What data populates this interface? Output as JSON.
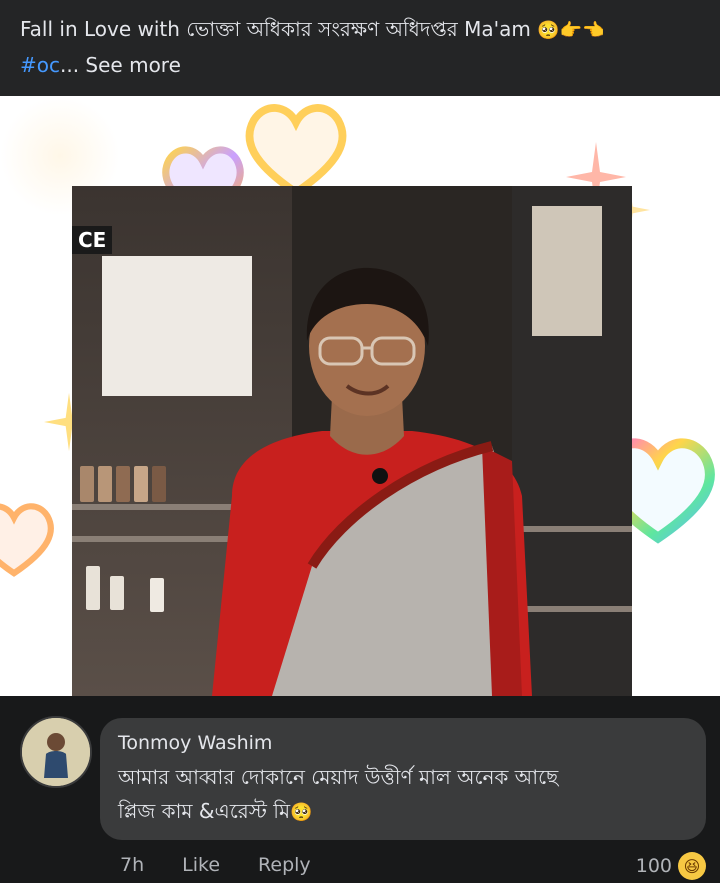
{
  "post": {
    "caption_text": "Fall in Love with ভোক্তা অধিকার সংরক্ষণ অধিদপ্তর Ma'am",
    "caption_emojis": "🥺👉👈",
    "hashtag": "#oc",
    "see_more": "... See more"
  },
  "photo": {
    "store_sign": "CE"
  },
  "comment": {
    "author": "Tonmoy Washim",
    "text_line1": "আমার আব্বার দোকানে মেয়াদ উত্তীর্ণ মাল অনেক আছে",
    "text_line2": "প্লিজ কাম &এরেস্ট মি",
    "text_emoji": "🥺",
    "time": "7h",
    "like_label": "Like",
    "reply_label": "Reply",
    "reaction_count": "100",
    "reaction_icon": "haha-emoji-icon"
  },
  "colors": {
    "background": "#18191a",
    "caption_bg": "#242526",
    "bubble_bg": "#3a3b3c",
    "hashtag": "#4599ff",
    "muted_text": "#b0b3b8"
  }
}
